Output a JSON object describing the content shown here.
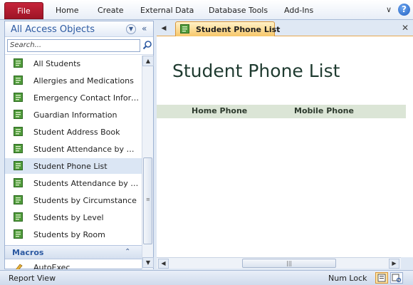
{
  "ribbon": {
    "file_label": "File",
    "tabs": [
      "Home",
      "Create",
      "External Data",
      "Database Tools",
      "Add-Ins"
    ],
    "help_label": "?"
  },
  "nav": {
    "title": "All Access Objects",
    "search_placeholder": "Search...",
    "items": [
      "All Students",
      "Allergies and Medications",
      "Emergency Contact Inform...",
      "Guardian Information",
      "Student Address Book",
      "Student Attendance by Da...",
      "Student Phone List",
      "Students Attendance by D...",
      "Students by Circumstance",
      "Students by Level",
      "Students by Room"
    ],
    "selected_item": "Student Phone List",
    "macros_header": "Macros",
    "macro_items": [
      "AutoExec"
    ]
  },
  "document": {
    "tab_label": "Student Phone List",
    "report_title": "Student Phone List",
    "columns": [
      "Home Phone",
      "Mobile Phone"
    ]
  },
  "status": {
    "left": "Report View",
    "num_lock": "Num Lock"
  },
  "colors": {
    "file_tab": "#b31b30",
    "nav_title": "#2d5aa2",
    "active_tab": "#f7c76a",
    "column_band": "#dbe5d6",
    "report_title": "#1f3b30"
  }
}
